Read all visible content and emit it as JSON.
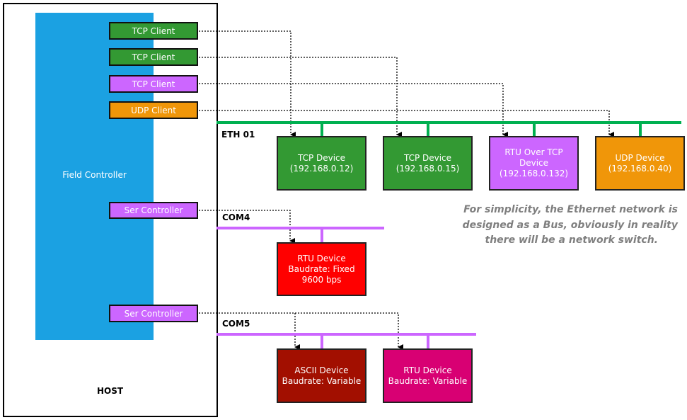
{
  "host": {
    "label": "HOST"
  },
  "field_controller": {
    "label": "Field Controller"
  },
  "clients": [
    {
      "label": "TCP Client",
      "color": "#339933"
    },
    {
      "label": "TCP Client",
      "color": "#339933"
    },
    {
      "label": "TCP Client",
      "color": "#cc66ff"
    },
    {
      "label": "UDP Client",
      "color": "#f09609"
    }
  ],
  "ser_controllers": [
    {
      "label": "Ser Controller",
      "color": "#cc66ff"
    },
    {
      "label": "Ser Controller",
      "color": "#cc66ff"
    }
  ],
  "buses": {
    "eth": {
      "label": "ETH 01",
      "color": "#00b050"
    },
    "com4": {
      "label": "COM4",
      "color": "#cc66ff"
    },
    "com5": {
      "label": "COM5",
      "color": "#cc66ff"
    }
  },
  "eth_devices": [
    {
      "line1": "TCP Device",
      "line2": "(192.168.0.12)",
      "color": "#339933"
    },
    {
      "line1": "TCP Device",
      "line2": "(192.168.0.15)",
      "color": "#339933"
    },
    {
      "line1": "RTU Over TCP Device",
      "line2": "(192.168.0.132)",
      "color": "#cc66ff"
    },
    {
      "line1": "UDP Device",
      "line2": "(192.168.0.40)",
      "color": "#f09609"
    }
  ],
  "com4_devices": [
    {
      "line1": "RTU Device",
      "line2": "Baudrate: Fixed",
      "line3": "9600 bps",
      "color": "#ff0000"
    }
  ],
  "com5_devices": [
    {
      "line1": "ASCII Device",
      "line2": "Baudrate: Variable",
      "color": "#a20f00"
    },
    {
      "line1": "RTU Device",
      "line2": "Baudrate: Variable",
      "color": "#d80073"
    }
  ],
  "note": {
    "line1": "For simplicity, the Ethernet network is",
    "line2": "designed as a Bus, obviously in reality",
    "line3": "there will be a network switch."
  }
}
